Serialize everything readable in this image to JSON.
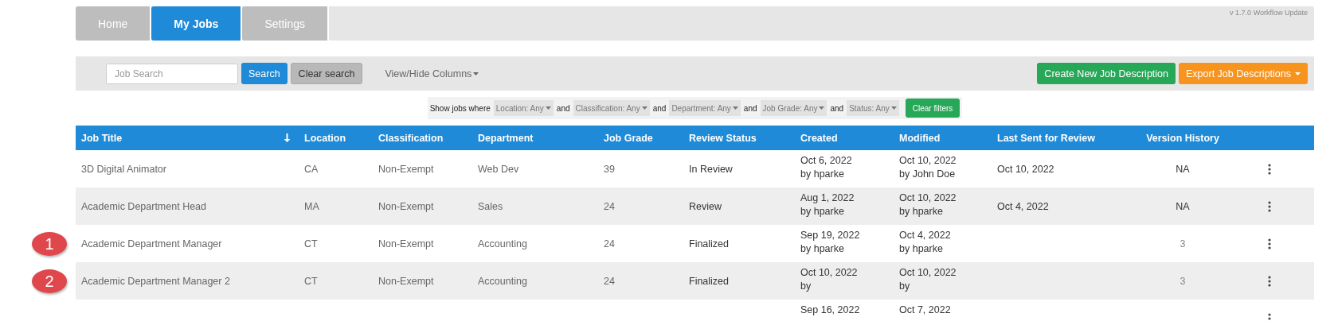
{
  "nav": {
    "tabs": [
      {
        "label": "Home",
        "selected": false
      },
      {
        "label": "My Jobs",
        "selected": true
      },
      {
        "label": "Settings",
        "selected": false
      }
    ],
    "version": "v 1.7.0 Workflow Update"
  },
  "toolbar": {
    "search": {
      "placeholder": "Job Search"
    },
    "search_button": "Search",
    "clear_button": "Clear search",
    "columns_menu": "View/Hide Columns",
    "create_button": "Create New Job Description",
    "export_button": "Export Job Descriptions"
  },
  "filters": {
    "lead": "Show jobs where",
    "items": [
      {
        "label": "Location: Any"
      },
      {
        "joiner": "and",
        "label": "Classification: Any"
      },
      {
        "joiner": "and",
        "label": "Department: Any"
      },
      {
        "joiner": "and",
        "label": "Job Grade: Any"
      },
      {
        "joiner": "and",
        "label": "Status: Any"
      }
    ],
    "clear": "Clear filters"
  },
  "table": {
    "columns": [
      "Job Title",
      "Location",
      "Classification",
      "Department",
      "Job Grade",
      "Review Status",
      "Created",
      "Modified",
      "Last Sent for Review",
      "Version History"
    ],
    "rows": [
      {
        "title": "3D Digital Animator",
        "location": "CA",
        "classification": "Non-Exempt",
        "department": "Web Dev",
        "grade": "39",
        "status": "In Review",
        "created": [
          "Oct 6, 2022",
          "by hparke"
        ],
        "modified": [
          "Oct 10, 2022",
          "by John Doe"
        ],
        "last_sent": "Oct 10, 2022",
        "version": "NA"
      },
      {
        "title": "Academic Department Head",
        "location": "MA",
        "classification": "Non-Exempt",
        "department": "Sales",
        "grade": "24",
        "status": "Review",
        "created": [
          "Aug 1, 2022",
          "by hparke"
        ],
        "modified": [
          "Oct 10, 2022",
          "by hparke"
        ],
        "last_sent": "Oct 4, 2022",
        "version": "NA"
      },
      {
        "callout": "1",
        "title": "Academic Department Manager",
        "location": "CT",
        "classification": "Non-Exempt",
        "department": "Accounting",
        "grade": "24",
        "status": "Finalized",
        "created": [
          "Sep 19, 2022",
          "by hparke"
        ],
        "modified": [
          "Oct 4, 2022",
          "by hparke"
        ],
        "version": "3"
      },
      {
        "callout": "2",
        "title": "Academic Department Manager 2",
        "location": "CT",
        "classification": "Non-Exempt",
        "department": "Accounting",
        "grade": "24",
        "status": "Finalized",
        "created": [
          "Oct 10, 2022",
          "by"
        ],
        "modified": [
          "Oct 10, 2022",
          "by"
        ],
        "version": "3"
      },
      {
        "created": [
          "Sep 16, 2022"
        ],
        "modified": [
          "Oct 7, 2022"
        ]
      }
    ]
  }
}
